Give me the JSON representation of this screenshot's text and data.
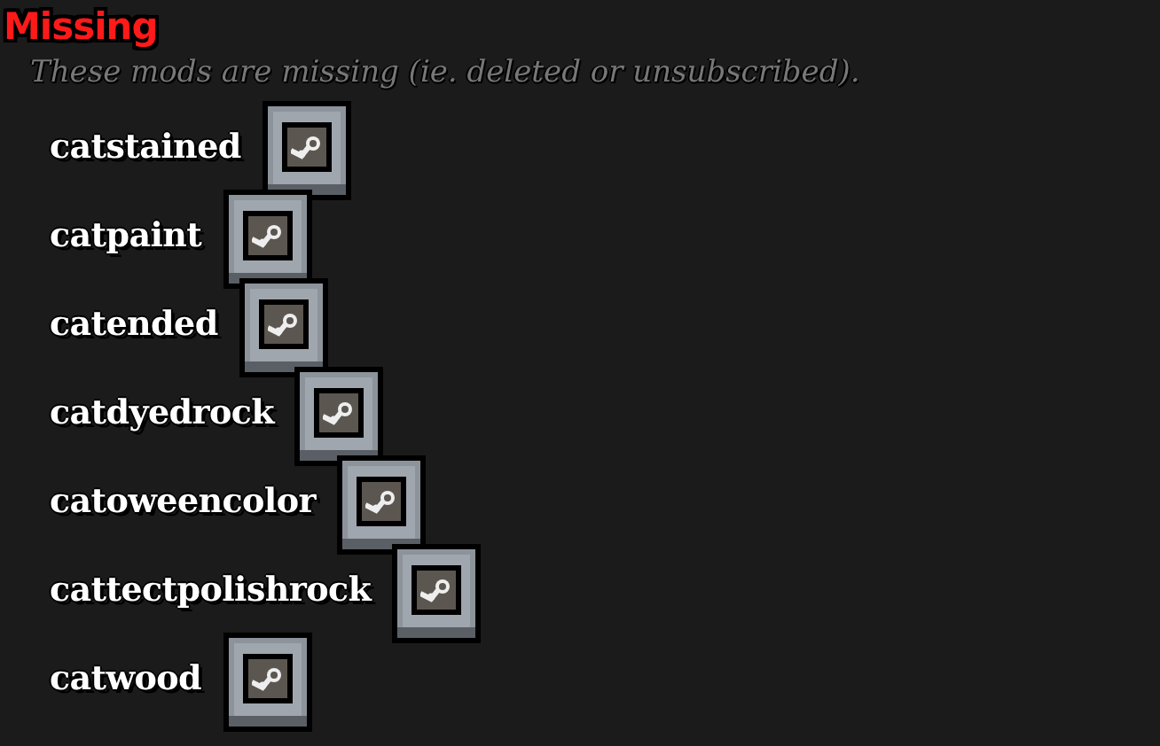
{
  "section": {
    "title": "Missing",
    "description": "These mods are missing (ie. deleted or unsubscribed)."
  },
  "mods": [
    {
      "name": "catstained"
    },
    {
      "name": "catpaint"
    },
    {
      "name": "catended"
    },
    {
      "name": "catdyedrock"
    },
    {
      "name": "catoweencolor"
    },
    {
      "name": "cattectpolishrock"
    },
    {
      "name": "catwood"
    }
  ]
}
